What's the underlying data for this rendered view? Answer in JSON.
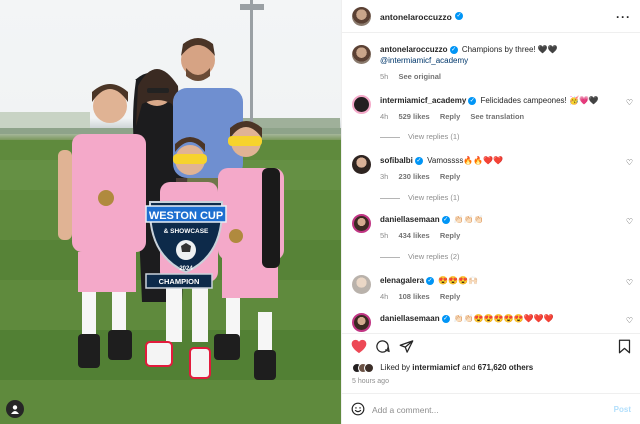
{
  "post_author": {
    "username": "antonelaroccuzzo",
    "verified": true
  },
  "caption": {
    "username": "antonelaroccuzzo",
    "text": "Champions by three! 🖤🖤",
    "mention": "@intermiamicf_academy",
    "time": "5h",
    "see_original": "See original"
  },
  "comments": [
    {
      "username": "intermiamicf_academy",
      "text": "Felicidades campeones! 🥳💗🖤",
      "time": "4h",
      "likes": "529 likes",
      "reply": "Reply",
      "see_translation": "See translation",
      "replies": "View replies (1)"
    },
    {
      "username": "sofibalbi",
      "text": "Vamossss🔥🔥❤️❤️",
      "time": "3h",
      "likes": "230 likes",
      "reply": "Reply",
      "replies": "View replies (1)"
    },
    {
      "username": "daniellasemaan",
      "text": "👏🏻👏🏻👏🏻",
      "time": "5h",
      "likes": "434 likes",
      "reply": "Reply",
      "replies": "View replies (2)"
    },
    {
      "username": "elenagalera",
      "text": "😍😍😍🙌🏻",
      "time": "4h",
      "likes": "108 likes",
      "reply": "Reply"
    },
    {
      "username": "daniellasemaan",
      "text": "👏🏻👏🏻😍😍😍😍😍❤️❤️❤️"
    }
  ],
  "liked_by": {
    "prefix": "Liked by ",
    "user": "intermiamicf",
    "middle": " and ",
    "count": "671,620 others"
  },
  "posted": "5 hours ago",
  "add_comment": {
    "placeholder": "Add a comment...",
    "post_label": "Post"
  },
  "photo_text": {
    "banner_top": "WESTON CUP",
    "banner_sub": "& SHOWCASE",
    "banner_champ": "CHAMPION",
    "year": "2024"
  },
  "colors": {
    "verified": "#0095f6",
    "like_active": "#ed4956",
    "jersey_pink": "#f4a9c9",
    "link": "#00376b"
  },
  "icons": [
    "more-icon",
    "heart-icon",
    "comment-icon",
    "share-icon",
    "save-icon",
    "emoji-icon",
    "user-tag-icon"
  ]
}
